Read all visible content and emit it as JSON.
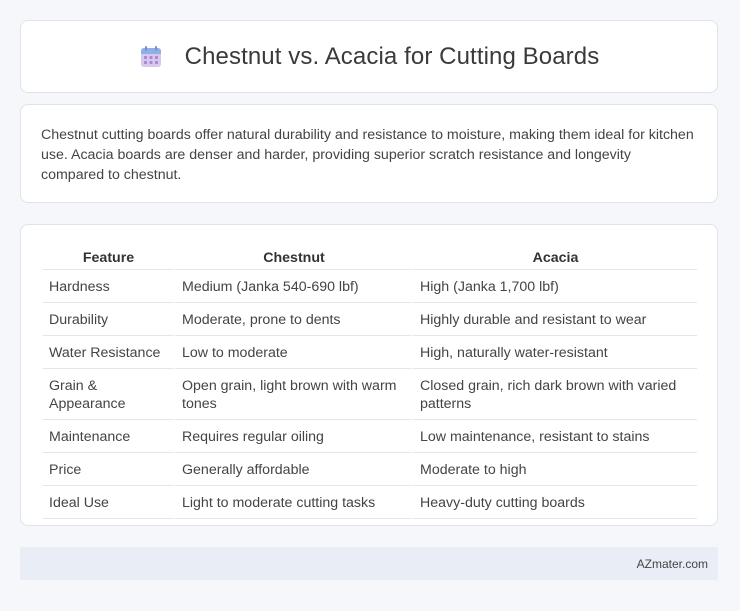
{
  "header": {
    "title": "Chestnut vs. Acacia for Cutting Boards",
    "icon": "calendar-icon"
  },
  "description": "Chestnut cutting boards offer natural durability and resistance to moisture, making them ideal for kitchen use. Acacia boards are denser and harder, providing superior scratch resistance and longevity compared to chestnut.",
  "table": {
    "headers": [
      "Feature",
      "Chestnut",
      "Acacia"
    ],
    "rows": [
      [
        "Hardness",
        "Medium (Janka 540-690 lbf)",
        "High (Janka 1,700 lbf)"
      ],
      [
        "Durability",
        "Moderate, prone to dents",
        "Highly durable and resistant to wear"
      ],
      [
        "Water Resistance",
        "Low to moderate",
        "High, naturally water-resistant"
      ],
      [
        "Grain & Appearance",
        "Open grain, light brown with warm tones",
        "Closed grain, rich dark brown with varied patterns"
      ],
      [
        "Maintenance",
        "Requires regular oiling",
        "Low maintenance, resistant to stains"
      ],
      [
        "Price",
        "Generally affordable",
        "Moderate to high"
      ],
      [
        "Ideal Use",
        "Light to moderate cutting tasks",
        "Heavy-duty cutting boards"
      ]
    ]
  },
  "footer": {
    "text": "AZmater.com"
  },
  "colors": {
    "background": "#f6f7fb",
    "card": "#ffffff",
    "footer": "#e9edf6",
    "icon_accent": "#b79ad8"
  }
}
